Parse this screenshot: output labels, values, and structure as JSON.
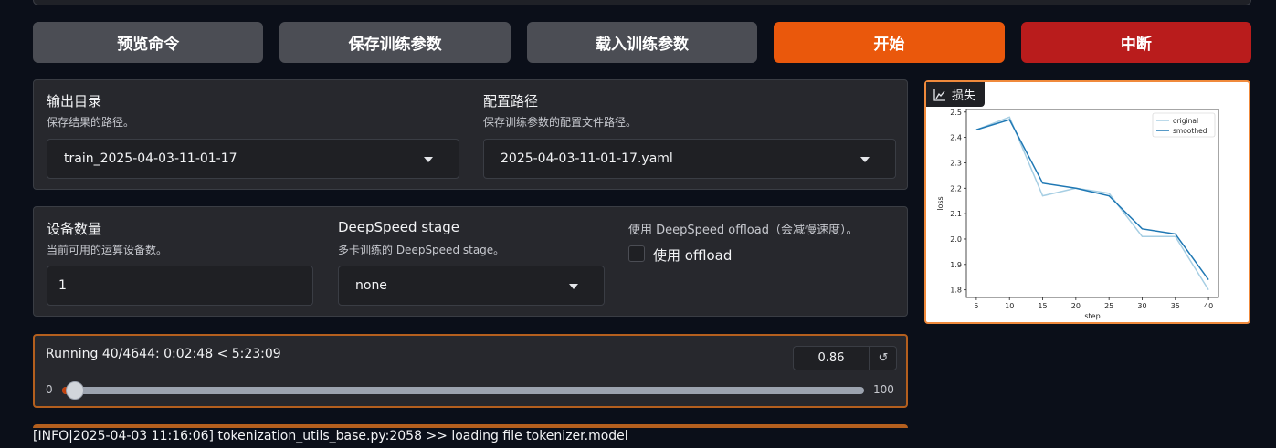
{
  "actions": {
    "preview": "预览命令",
    "save_args": "保存训练参数",
    "load_args": "载入训练参数",
    "start": "开始",
    "abort": "中断"
  },
  "output_dir": {
    "label": "输出目录",
    "info": "保存结果的路径。",
    "value": "train_2025-04-03-11-01-17"
  },
  "config_path": {
    "label": "配置路径",
    "info": "保存训练参数的配置文件路径。",
    "value": "2025-04-03-11-01-17.yaml"
  },
  "device_count": {
    "label": "设备数量",
    "info": "当前可用的运算设备数。",
    "value": "1"
  },
  "ds_stage": {
    "label": "DeepSpeed stage",
    "info": "多卡训练的 DeepSpeed stage。",
    "value": "none"
  },
  "ds_offload": {
    "info": "使用 DeepSpeed offload（会减慢速度）。",
    "label": "使用 offload"
  },
  "progress": {
    "text": "Running 40/4644: 0:02:48 < 5:23:09",
    "value": "0.86",
    "reset_icon": "↺",
    "min": "0",
    "max": "100",
    "fraction": 0.0086
  },
  "log": {
    "line": "[INFO|2025-04-03 11:16:06] tokenization_utils_base.py:2058 >> loading file tokenizer.model"
  },
  "loss_plot": {
    "label": "损失",
    "icon": "chart-icon"
  },
  "colors": {
    "primary": "#ea580c",
    "stop": "#b91c1c",
    "original_line": "#a6cee3",
    "smoothed_line": "#1f78b4"
  },
  "chart_data": {
    "type": "line",
    "xlabel": "step",
    "ylabel": "loss",
    "x": [
      5,
      10,
      15,
      20,
      25,
      30,
      35,
      40
    ],
    "xlim": [
      3.5,
      41.5
    ],
    "ylim": [
      1.77,
      2.51
    ],
    "xticks": [
      "5",
      "10",
      "15",
      "20",
      "25",
      "30",
      "35",
      "40"
    ],
    "yticks": [
      "1.8",
      "1.9",
      "2.0",
      "2.1",
      "2.2",
      "2.3",
      "2.4",
      "2.5"
    ],
    "legend_position": "top-right",
    "series": [
      {
        "name": "original",
        "values": [
          2.43,
          2.48,
          2.17,
          2.2,
          2.18,
          2.01,
          2.01,
          1.8
        ]
      },
      {
        "name": "smoothed",
        "values": [
          2.43,
          2.47,
          2.22,
          2.2,
          2.17,
          2.04,
          2.02,
          1.84
        ]
      }
    ]
  }
}
